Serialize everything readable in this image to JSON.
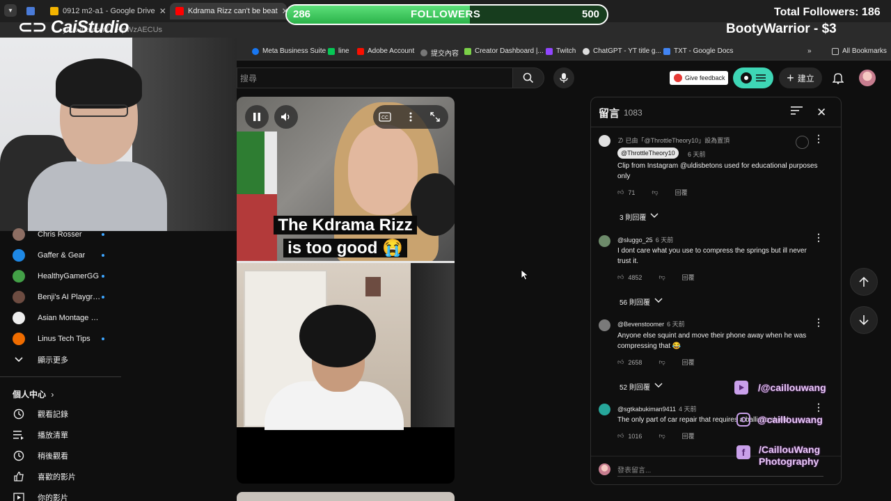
{
  "browser": {
    "tabs": [
      {
        "label": "",
        "favicon_color": "#4a7bd8"
      },
      {
        "label": "0912 m2-a1 - Google Drive",
        "favicon_color": "#f4b400"
      },
      {
        "label": "Kdrama Rizz can't be beat",
        "favicon_color": "#ff0000"
      }
    ],
    "url": "youtube.com/…HpWzAECUs",
    "bookmarks": [
      {
        "label": "Meta Business Suite",
        "color": "#1877f2"
      },
      {
        "label": "line",
        "color": "#06c755"
      },
      {
        "label": "Adobe Account",
        "color": "#fa0f00"
      },
      {
        "label": "提交內容",
        "color": "#777777"
      },
      {
        "label": "Creator Dashboard |...",
        "color": "#7bd148"
      },
      {
        "label": "Twitch",
        "color": "#9146ff"
      },
      {
        "label": "ChatGPT - YT title g...",
        "color": "#dddddd"
      },
      {
        "label": "TXT - Google Docs",
        "color": "#4285f4"
      }
    ],
    "all_bookmarks": "All Bookmarks"
  },
  "youtube": {
    "search_placeholder": "搜尋",
    "feedback_label": "Give feedback",
    "create_label": "建立"
  },
  "sidebar": {
    "subscriptions": [
      {
        "label": "Chris Rosser",
        "color": "#8d6e63"
      },
      {
        "label": "Gaffer & Gear",
        "color": "#1e88e5"
      },
      {
        "label": "HealthyGamerGG",
        "color": "#43a047"
      },
      {
        "label": "Benji's AI Playgro...",
        "color": "#6d4c41"
      },
      {
        "label": "Asian Montage Film",
        "color": "#eeeeee"
      },
      {
        "label": "Linus Tech Tips",
        "color": "#ef6c00"
      }
    ],
    "show_more": "顯示更多",
    "you_section": "個人中心",
    "you_items": [
      {
        "label": "觀看記錄",
        "icon": "history-icon"
      },
      {
        "label": "播放清單",
        "icon": "playlist-icon"
      },
      {
        "label": "稍後觀看",
        "icon": "clock-icon"
      },
      {
        "label": "喜歡的影片",
        "icon": "thumbs-up-icon"
      },
      {
        "label": "你的影片",
        "icon": "video-icon"
      }
    ]
  },
  "video": {
    "caption_line1": "The Kdrama Rizz",
    "caption_line2": "is too good 😭"
  },
  "comments": {
    "title": "留言",
    "count": "1083",
    "input_placeholder": "發表留言...",
    "pinned_note": "已由「@ThrottleTheory10」設為置頂",
    "items": [
      {
        "author": "@ThrottleTheory10",
        "time": "6 天前",
        "text": "Clip from Instagram @uldisbetons used for educational purposes only",
        "likes": "71",
        "reply": "回覆",
        "replies": "3 則回覆",
        "avatar_color": "#e0e0e0"
      },
      {
        "author": "@sluggo_25",
        "time": "6 天前",
        "text": "I dont care what you use to compress the springs but ill never trust it.",
        "likes": "4852",
        "reply": "回覆",
        "replies": "56 則回覆",
        "avatar_color": "#6d8a6a"
      },
      {
        "author": "@Bevenstoomer",
        "time": "6 天前",
        "text": "Anyone else squint and move their phone away when he was compressing that 😂",
        "likes": "2658",
        "reply": "回覆",
        "replies": "52 則回覆",
        "avatar_color": "#7a7a7a"
      },
      {
        "author": "@sgtkabukiman9411",
        "time": "4 天前",
        "text": "The only part of car repair that requires a ballistic shield",
        "likes": "1016",
        "reply": "回覆",
        "replies": "",
        "avatar_color": "#26a69a"
      }
    ]
  },
  "overlay": {
    "logo": "CaiStudio",
    "followers_current": "286",
    "followers_label": "FOLLOWERS",
    "followers_goal": "500",
    "followers_progress": 0.572,
    "total_followers": "Total Followers: 186",
    "donation": "BootyWarrior - $3",
    "social_youtube": "/@caillouwang",
    "social_instagram": "@caillouwang",
    "social_facebook_1": "/CaillouWang",
    "social_facebook_2": "Photography"
  }
}
